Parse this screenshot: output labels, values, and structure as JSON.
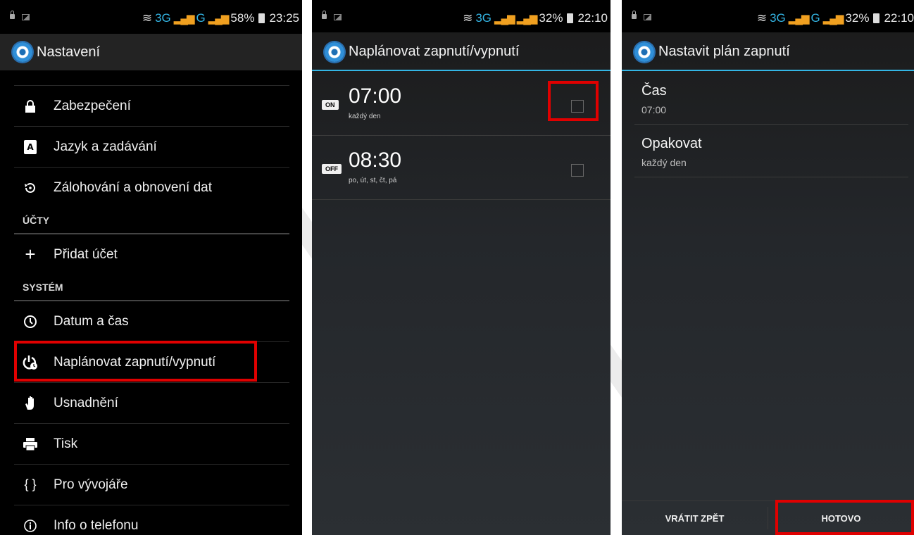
{
  "panel1": {
    "status": {
      "network": "3G",
      "network2": "G",
      "battery": "58%",
      "time": "23:25"
    },
    "title": "Nastavení",
    "items_top": [
      {
        "label": "Zabezpečení",
        "icon": "lock-icon"
      },
      {
        "label": "Jazyk a zadávání",
        "icon": "keyboard-a-icon"
      },
      {
        "label": "Zálohování a obnovení dat",
        "icon": "restore-icon"
      }
    ],
    "header_accounts": "ÚČTY",
    "add_account": "Přidat účet",
    "header_system": "SYSTÉM",
    "items_system": [
      {
        "label": "Datum a čas",
        "icon": "clock-icon"
      },
      {
        "label": "Naplánovat zapnutí/vypnutí",
        "icon": "power-schedule-icon"
      },
      {
        "label": "Usnadnění",
        "icon": "hand-icon"
      },
      {
        "label": "Tisk",
        "icon": "printer-icon"
      },
      {
        "label": "Pro vývojáře",
        "icon": "braces-icon"
      },
      {
        "label": "Info o telefonu",
        "icon": "info-icon"
      }
    ]
  },
  "panel2": {
    "status": {
      "network": "3G",
      "network2": "",
      "battery": "32%",
      "time": "22:10"
    },
    "title": "Naplánovat zapnutí/vypnutí",
    "schedules": [
      {
        "badge": "ON",
        "time": "07:00",
        "days": "každý den",
        "checked": false
      },
      {
        "badge": "OFF",
        "time": "08:30",
        "days": "po, út, st, čt, pá",
        "checked": false
      }
    ]
  },
  "panel3": {
    "status": {
      "network": "3G",
      "network2": "G",
      "battery": "32%",
      "time": "22:10"
    },
    "title": "Nastavit plán zapnutí",
    "prefs": [
      {
        "title": "Čas",
        "value": "07:00"
      },
      {
        "title": "Opakovat",
        "value": "každý den"
      }
    ],
    "revert_label": "VRÁTIT ZPĚT",
    "done_label": "HOTOVO"
  },
  "colors": {
    "accent": "#33b5e5",
    "highlight": "#e00000",
    "signal": "#f0a020"
  }
}
